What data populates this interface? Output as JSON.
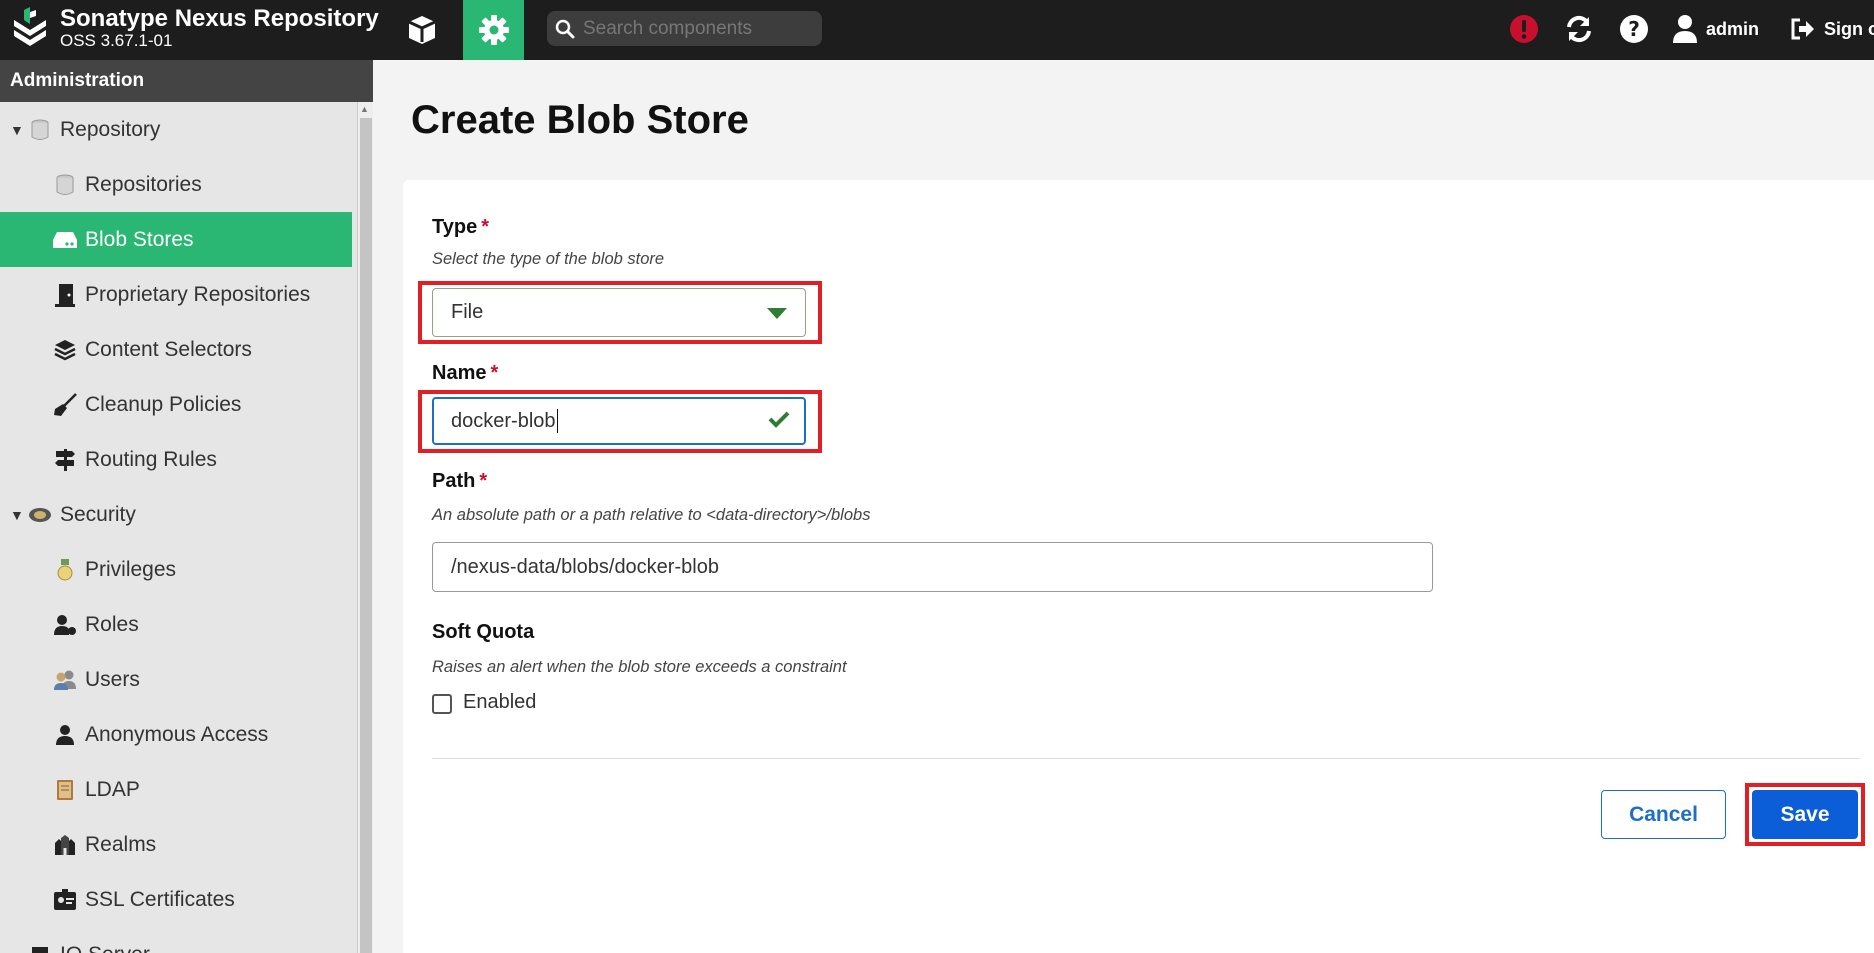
{
  "app": {
    "title": "Sonatype Nexus Repository",
    "version": "OSS 3.67.1-01"
  },
  "topbar": {
    "search_placeholder": "Search components",
    "user_name": "admin",
    "signout_label": "Sign out",
    "accent_color": "#2ab673"
  },
  "sidebar": {
    "header": "Administration",
    "items": [
      {
        "label": "Repository",
        "icon": "database-icon",
        "level": 1,
        "expanded": true
      },
      {
        "label": "Repositories",
        "icon": "database-icon",
        "level": 2
      },
      {
        "label": "Blob Stores",
        "icon": "hard-drive-icon",
        "level": 2,
        "active": true
      },
      {
        "label": "Proprietary Repositories",
        "icon": "door-icon",
        "level": 2
      },
      {
        "label": "Content Selectors",
        "icon": "layers-icon",
        "level": 2
      },
      {
        "label": "Cleanup Policies",
        "icon": "broom-icon",
        "level": 2
      },
      {
        "label": "Routing Rules",
        "icon": "signpost-icon",
        "level": 2
      },
      {
        "label": "Security",
        "icon": "badge-icon",
        "level": 1,
        "expanded": true
      },
      {
        "label": "Privileges",
        "icon": "medal-icon",
        "level": 2
      },
      {
        "label": "Roles",
        "icon": "user-role-icon",
        "level": 2
      },
      {
        "label": "Users",
        "icon": "users-icon",
        "level": 2
      },
      {
        "label": "Anonymous Access",
        "icon": "user-icon",
        "level": 2
      },
      {
        "label": "LDAP",
        "icon": "book-icon",
        "level": 2
      },
      {
        "label": "Realms",
        "icon": "realms-icon",
        "level": 2
      },
      {
        "label": "SSL Certificates",
        "icon": "id-card-icon",
        "level": 2
      },
      {
        "label": "IQ Server",
        "icon": "iq-icon",
        "level": 1
      }
    ]
  },
  "main": {
    "title": "Create Blob Store",
    "type_field": {
      "label": "Type",
      "required": "*",
      "help": "Select the type of the blob store",
      "value": "File"
    },
    "name_field": {
      "label": "Name",
      "required": "*",
      "value": "docker-blob"
    },
    "path_field": {
      "label": "Path",
      "required": "*",
      "help": "An absolute path or a path relative to <data-directory>/blobs",
      "value": "/nexus-data/blobs/docker-blob"
    },
    "soft_quota": {
      "label": "Soft Quota",
      "help": "Raises an alert when the blob store exceeds a constraint",
      "checkbox_label": "Enabled",
      "checked": false
    },
    "cancel_label": "Cancel",
    "save_label": "Save",
    "highlight_color": "#e01f27"
  }
}
